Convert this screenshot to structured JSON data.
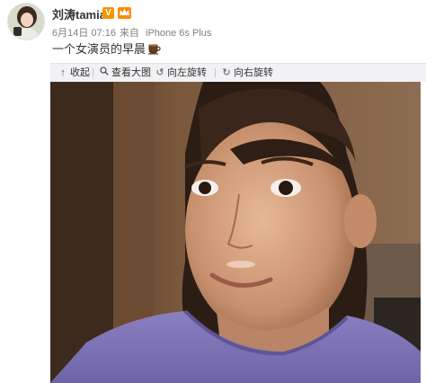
{
  "post": {
    "username": "刘涛tamia",
    "vip_badge": "V",
    "date": "6月14日 07:16",
    "source_prefix": "来自",
    "source_device": "iPhone 6s Plus",
    "content": "一个女演员的早晨"
  },
  "toolbar": {
    "collapse": "收起",
    "view_large": "查看大图",
    "rotate_left": "向左旋转",
    "rotate_right": "向右旋转"
  },
  "icons": {
    "vip": "verified-v-icon",
    "crown": "member-crown-icon",
    "coffee": "coffee-cup-icon",
    "collapse": "collapse-arrow-icon",
    "zoom": "magnifier-icon",
    "rotate_left": "rotate-left-icon",
    "rotate_right": "rotate-right-icon"
  },
  "colors": {
    "username": "#333333",
    "meta": "#808080",
    "vip_badge": "#f39800",
    "toolbar_bg": "#f2f2f5"
  }
}
